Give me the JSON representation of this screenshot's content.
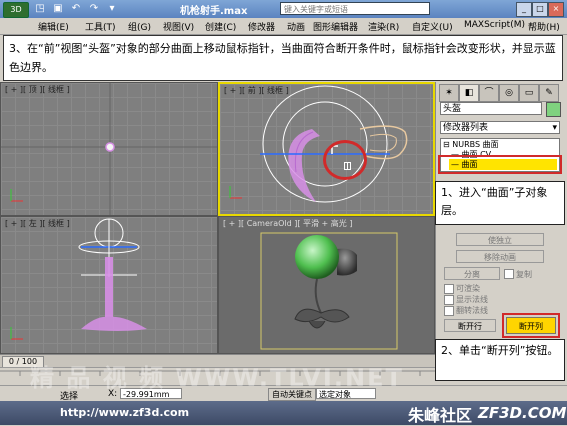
{
  "titlebar": {
    "app_icon_label": "3D",
    "quick_access": [
      "◳",
      "▣",
      "↶",
      "↷",
      "▾"
    ],
    "title": "机枪射手.max",
    "search_placeholder": "键入关键字或短语",
    "controls": [
      "_",
      "□",
      "×"
    ]
  },
  "menu": {
    "items": [
      "编辑(E)",
      "工具(T)",
      "组(G)",
      "视图(V)",
      "创建(C)",
      "修改器",
      "动画",
      "图形编辑器",
      "渲染(R)",
      "自定义(U)",
      "MAXScript(M)"
    ],
    "help": "帮助(H)"
  },
  "banner": {
    "text": "3、在“前”视图“头盔”对象的部分曲面上移动鼠标指针，当曲面符合断开条件时，鼠标指针会改变形状，并显示蓝色边界。"
  },
  "viewports": {
    "top_label": "[ + ][ 顶 ][ 线框 ]",
    "front_label": "[ + ][ 前 ][ 线框 ]",
    "left_label": "[ + ][ 左 ][ 线框 ]",
    "persp_label": "[ + ][ CameraOld ][ 平滑 + 高光 ]"
  },
  "command_panel": {
    "tabs": [
      "✶",
      "◧",
      "⌒",
      "◎",
      "▭",
      "✎"
    ],
    "object_name": "头盔",
    "modifier_list": "修改器列表",
    "stack": {
      "root": "NURBS 曲面",
      "sub1": "曲面 CV",
      "sub2": "曲面"
    },
    "buttons": {
      "make_independent": "使独立",
      "remove_anim": "移除动画",
      "detach": "分离",
      "copy_label": "复制",
      "break_row": "断开行",
      "break_col": "断开列"
    },
    "checkboxes": [
      "可渲染",
      "显示法线",
      "翻转法线"
    ]
  },
  "callouts": {
    "step1": "1、进入“曲面”子对象层。",
    "step2": "2、单击“断开列”按钮。"
  },
  "timeline": {
    "frame": "0 / 100"
  },
  "status": {
    "prompt": "选择",
    "x_label": "X:",
    "x_value": "-29.991mm",
    "auto_key": "自动关键点",
    "selected": "选定对象"
  },
  "footer": {
    "url": "http://www.zf3d.com",
    "brand": "朱峰社区",
    "site": "ZF3D.COM"
  },
  "watermark": "精 品 视 频  WWW.TLVI.NET",
  "colors": {
    "highlight": "#ffe400",
    "callout_border": "#d12a2a",
    "title_bar": "#5b83c0",
    "nurbs_pink": "#d78fe6",
    "object_green": "#6fcf6f"
  }
}
